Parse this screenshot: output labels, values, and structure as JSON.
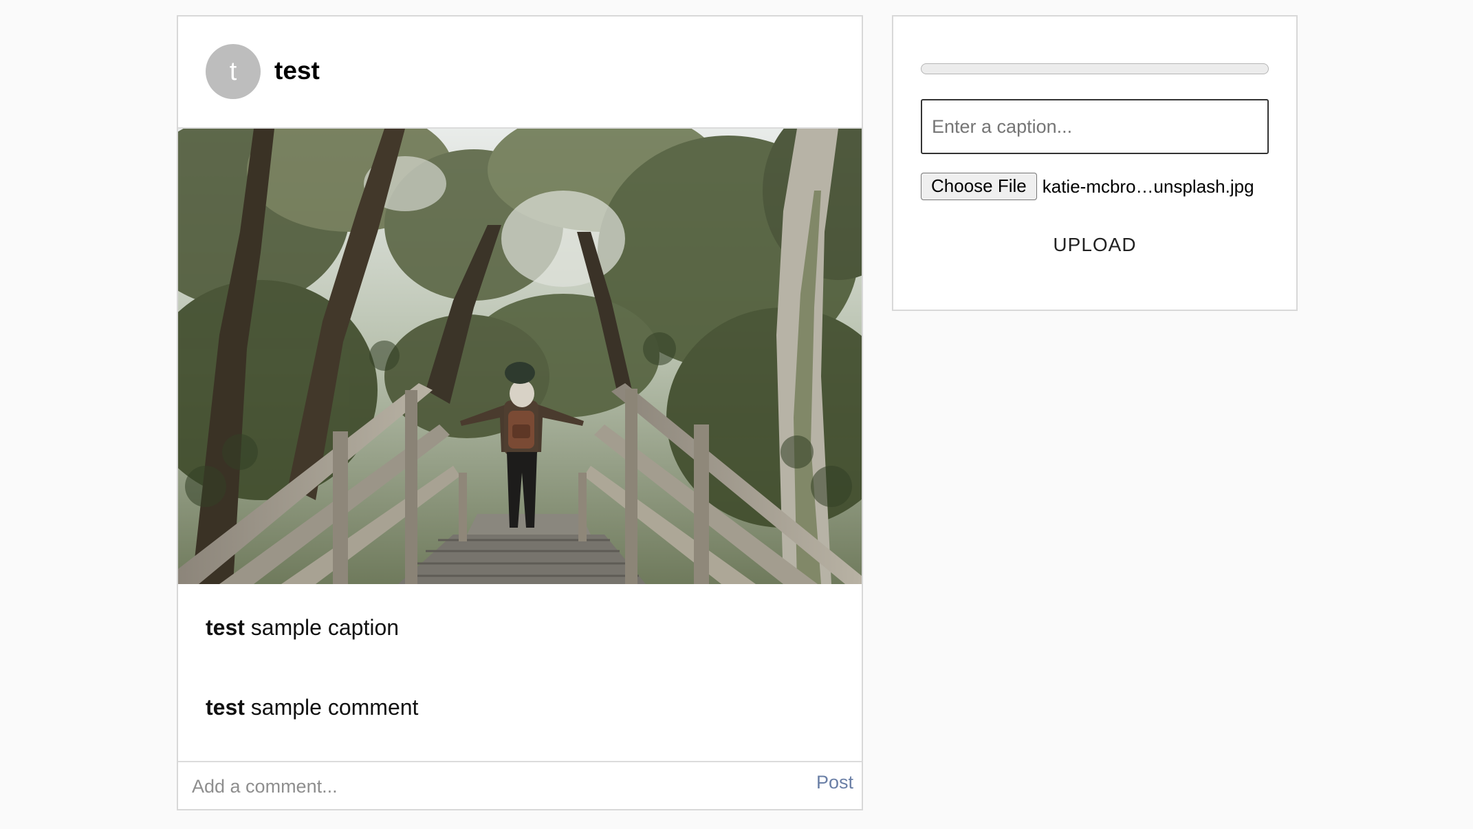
{
  "post": {
    "avatar_letter": "t",
    "username": "test",
    "image_alt": "Person with backpack walking down wooden stairs through a forest",
    "caption": {
      "user": "test",
      "text": " sample caption"
    },
    "comments": [
      {
        "user": "test",
        "text": " sample comment"
      }
    ],
    "comment_placeholder": "Add a comment...",
    "post_label": "Post"
  },
  "upload": {
    "progress": 0,
    "caption_placeholder": "Enter a caption...",
    "choose_file_label": "Choose File",
    "file_name": "katie-mcbro…unsplash.jpg",
    "upload_label": "UPLOAD"
  },
  "colors": {
    "page_bg": "#fafafa",
    "card_border": "#d8d8d8",
    "avatar_bg": "#bdbdbd",
    "post_link": "#6a7fa6"
  }
}
